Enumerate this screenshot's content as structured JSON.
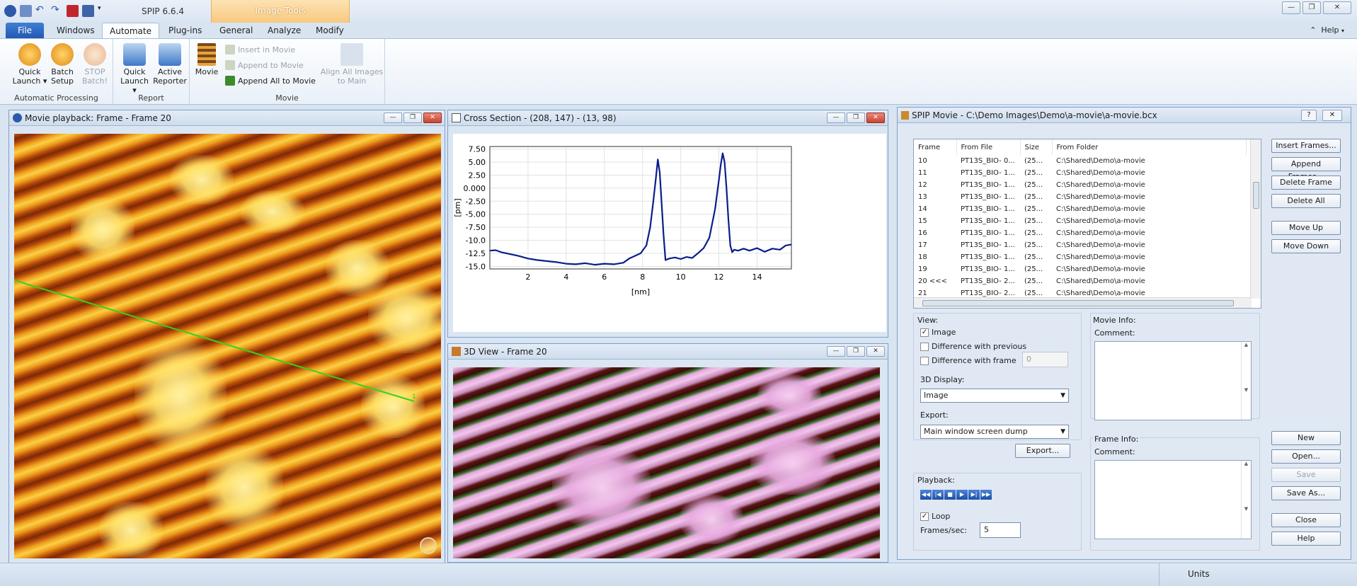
{
  "app": {
    "title": "SPIP 6.6.4",
    "context_tab": "Image Tools"
  },
  "tabs": [
    "File",
    "Windows",
    "Automate",
    "Plug-ins",
    "General",
    "Analyze",
    "Modify"
  ],
  "help_label": "Help",
  "ribbon": {
    "groups": {
      "automatic_processing": "Automatic Processing",
      "report": "Report",
      "movie": "Movie"
    },
    "buttons": {
      "quick_launch_1": "Quick Launch",
      "batch_setup": "Batch Setup",
      "stop_batch": "STOP Batch!",
      "quick_launch_2": "Quick Launch",
      "active_reporter": "Active Reporter",
      "movie": "Movie",
      "insert_in_movie": "Insert in Movie",
      "append_to_movie": "Append to Movie",
      "append_all_to_movie": "Append All to Movie",
      "align_all": "Align All Images to Main"
    }
  },
  "windows": {
    "playback": {
      "title": "Movie playback: Frame - Frame 20"
    },
    "cross_section": {
      "title": "Cross Section -  (208, 147) - (13, 98)"
    },
    "view3d": {
      "title": "3D View - Frame 20"
    }
  },
  "chart_data": {
    "type": "line",
    "title": "",
    "xlabel": "[nm]",
    "ylabel": "[pm]",
    "xlim": [
      0,
      15.8
    ],
    "ylim": [
      -15.5,
      8.0
    ],
    "xticks": [
      2,
      4,
      6,
      8,
      10,
      12,
      14
    ],
    "yticks": [
      7.5,
      5.0,
      2.5,
      0.0,
      -2.5,
      -5.0,
      -7.5,
      -10.0,
      -12.5,
      -15.0
    ],
    "ytick_labels": [
      "7.50",
      "5.00",
      "2.50",
      "0.000",
      "-2.50",
      "-5.00",
      "-7.50",
      "-10.0",
      "-12.5",
      "-15.0"
    ],
    "grid": true,
    "color": "#0b1d8a",
    "x": [
      0,
      0.3,
      0.6,
      1.0,
      1.5,
      2.0,
      2.5,
      3.0,
      3.5,
      4.0,
      4.5,
      5.0,
      5.5,
      6.0,
      6.5,
      7.0,
      7.3,
      7.6,
      7.9,
      8.2,
      8.4,
      8.55,
      8.7,
      8.8,
      8.9,
      9.0,
      9.1,
      9.2,
      9.4,
      9.7,
      10.0,
      10.3,
      10.6,
      10.9,
      11.2,
      11.5,
      11.8,
      12.0,
      12.1,
      12.2,
      12.3,
      12.4,
      12.5,
      12.6,
      12.7,
      12.8,
      13.0,
      13.3,
      13.6,
      14.0,
      14.4,
      14.8,
      15.2,
      15.5,
      15.8
    ],
    "y": [
      -12.0,
      -11.9,
      -12.3,
      -12.6,
      -13.0,
      -13.5,
      -13.8,
      -14.0,
      -14.2,
      -14.5,
      -14.6,
      -14.4,
      -14.7,
      -14.5,
      -14.6,
      -14.3,
      -13.5,
      -13.0,
      -12.5,
      -11.0,
      -7.5,
      -3.0,
      2.0,
      5.5,
      3.0,
      -3.0,
      -9.0,
      -13.8,
      -13.5,
      -13.3,
      -13.6,
      -13.2,
      -13.4,
      -12.5,
      -11.5,
      -9.5,
      -4.0,
      1.5,
      4.5,
      6.7,
      5.0,
      0.0,
      -6.0,
      -11.0,
      -12.3,
      -11.8,
      -12.0,
      -11.6,
      -12.0,
      -11.5,
      -12.2,
      -11.6,
      -11.8,
      -11.0,
      -10.8
    ]
  },
  "movie_dialog": {
    "title": "SPIP Movie - C:\\Demo Images\\Demo\\a-movie\\a-movie.bcx",
    "columns": [
      "Frame",
      "From File",
      "Size",
      "From Folder"
    ],
    "rows": [
      [
        "10",
        "PT13S_BIO- 0...",
        "(25...",
        "C:\\Shared\\Demo\\a-movie"
      ],
      [
        "11",
        "PT13S_BIO- 1...",
        "(25...",
        "C:\\Shared\\Demo\\a-movie"
      ],
      [
        "12",
        "PT13S_BIO- 1...",
        "(25...",
        "C:\\Shared\\Demo\\a-movie"
      ],
      [
        "13",
        "PT13S_BIO- 1...",
        "(25...",
        "C:\\Shared\\Demo\\a-movie"
      ],
      [
        "14",
        "PT13S_BIO- 1...",
        "(25...",
        "C:\\Shared\\Demo\\a-movie"
      ],
      [
        "15",
        "PT13S_BIO- 1...",
        "(25...",
        "C:\\Shared\\Demo\\a-movie"
      ],
      [
        "16",
        "PT13S_BIO- 1...",
        "(25...",
        "C:\\Shared\\Demo\\a-movie"
      ],
      [
        "17",
        "PT13S_BIO- 1...",
        "(25...",
        "C:\\Shared\\Demo\\a-movie"
      ],
      [
        "18",
        "PT13S_BIO- 1...",
        "(25...",
        "C:\\Shared\\Demo\\a-movie"
      ],
      [
        "19",
        "PT13S_BIO- 1...",
        "(25...",
        "C:\\Shared\\Demo\\a-movie"
      ],
      [
        "20 <<<",
        "PT13S_BIO- 2...",
        "(25...",
        "C:\\Shared\\Demo\\a-movie"
      ],
      [
        "21",
        "PT13S_BIO- 2...",
        "(25...",
        "C:\\Shared\\Demo\\a-movie"
      ]
    ],
    "side_buttons": {
      "insert_frames": "Insert Frames...",
      "append_frames": "Append Frames...",
      "delete_frame": "Delete Frame",
      "delete_all": "Delete All",
      "move_up": "Move Up",
      "move_down": "Move Down",
      "new": "New",
      "open": "Open...",
      "save": "Save",
      "save_as": "Save As...",
      "close": "Close",
      "help": "Help"
    },
    "view": {
      "label": "View:",
      "image": "Image",
      "diff_prev": "Difference with previous",
      "diff_frame": "Difference with frame",
      "diff_frame_value": "0",
      "display_label": "3D Display:",
      "display_value": "Image",
      "export_label": "Export:",
      "export_value": "Main window screen dump",
      "export_button": "Export..."
    },
    "playback": {
      "label": "Playback:",
      "loop": "Loop",
      "fps_label": "Frames/sec:",
      "fps_value": "5"
    },
    "movie_info": {
      "label": "Movie Info:",
      "comment": "Comment:"
    },
    "frame_info": {
      "label": "Frame Info:",
      "comment": "Comment:"
    }
  },
  "status": {
    "units": "Units"
  }
}
